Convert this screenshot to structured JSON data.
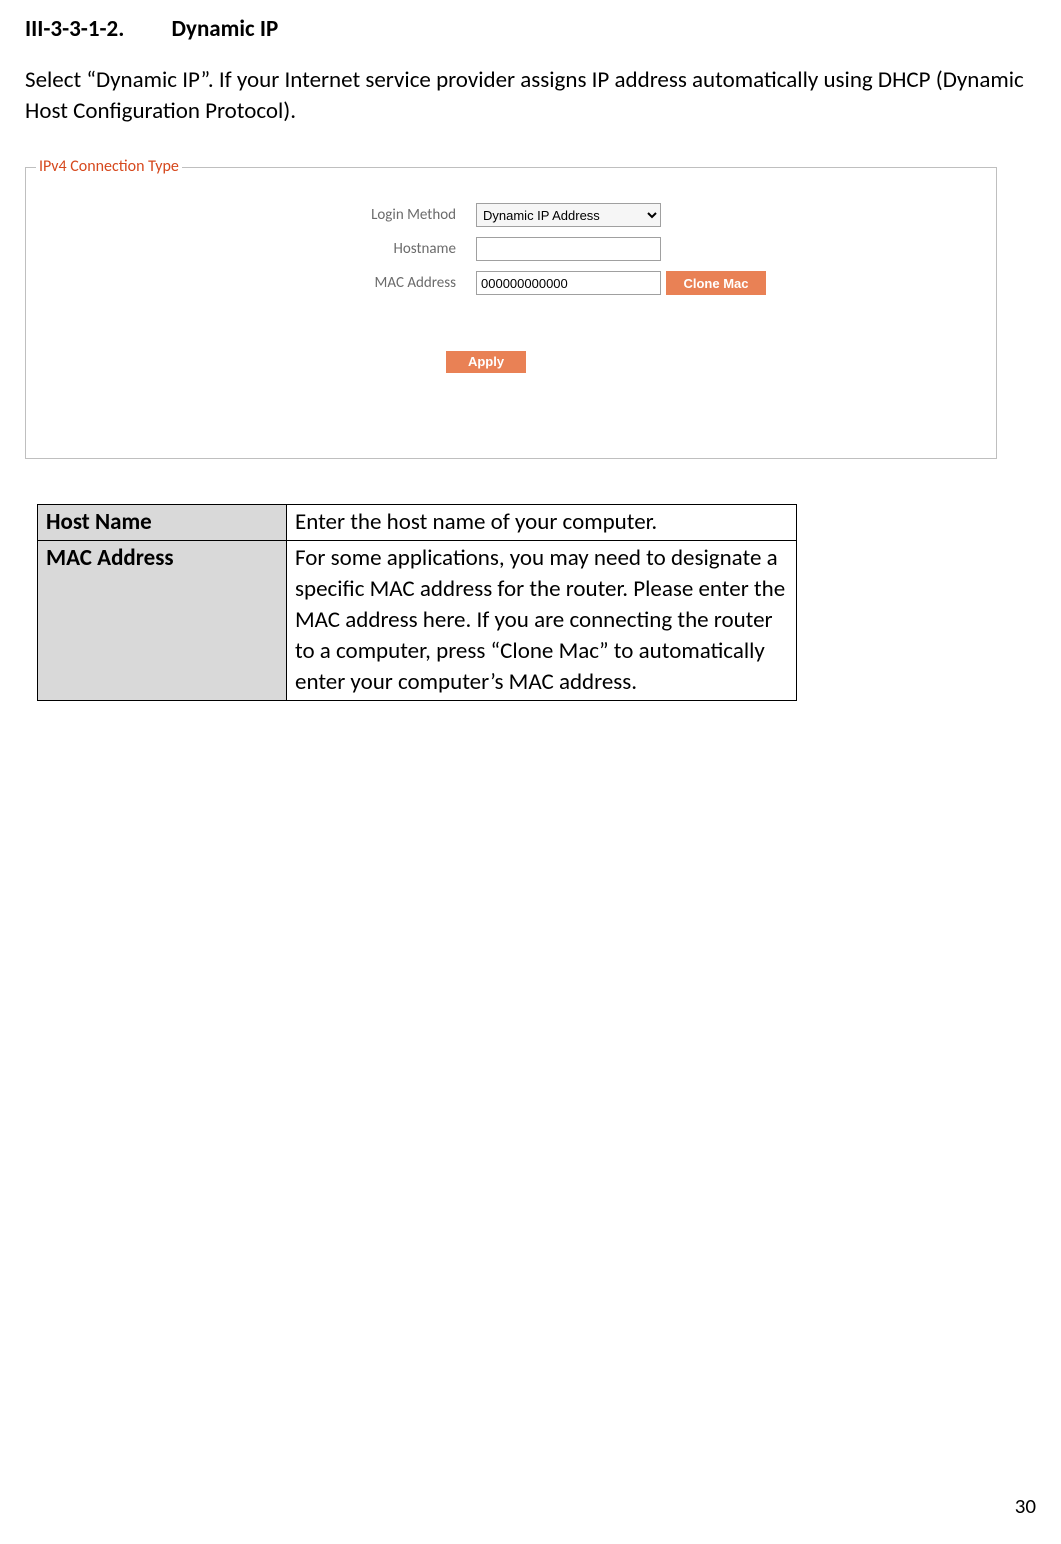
{
  "heading": {
    "number": "III-3-3-1-2.",
    "title": "Dynamic IP"
  },
  "intro": "Select “Dynamic IP”. If your Internet service provider assigns IP address automatically using DHCP (Dynamic Host Configuration Protocol).",
  "fieldset": {
    "legend": "IPv4 Connection Type",
    "rows": {
      "login_method_label": "Login Method",
      "login_method_value": "Dynamic IP Address",
      "hostname_label": "Hostname",
      "hostname_value": "",
      "mac_label": "MAC Address",
      "mac_value": "000000000000",
      "clone_button": "Clone Mac",
      "apply_button": "Apply"
    }
  },
  "table": {
    "row1": {
      "key": "Host Name",
      "val": "Enter the host name of your computer."
    },
    "row2": {
      "key": "MAC Address",
      "val": "For some applications, you may need to designate a specific MAC address for the router. Please enter the MAC address here. If you are connecting the router to a computer, press “Clone Mac” to automatically enter your computer’s MAC address."
    }
  },
  "page_number": "30"
}
